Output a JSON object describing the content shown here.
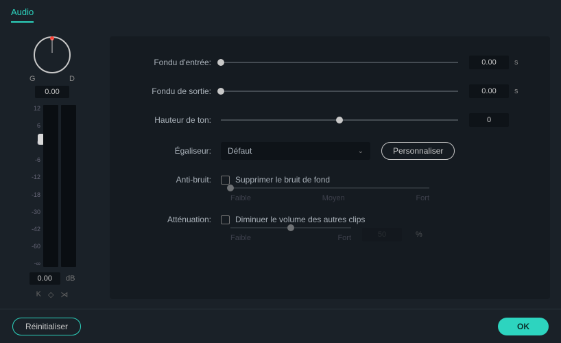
{
  "tab": {
    "label": "Audio"
  },
  "pan": {
    "left_label": "G",
    "right_label": "D",
    "value": "0.00"
  },
  "meter": {
    "ticks": [
      "12",
      "6",
      "0",
      "-6",
      "-12",
      "-18",
      "-30",
      "-42",
      "-60",
      "-∞"
    ],
    "volume_value": "0.00",
    "volume_unit": "dB"
  },
  "controls": {
    "fade_in": {
      "label": "Fondu d'entrée:",
      "value": "0.00",
      "unit": "s",
      "pos_pct": 0
    },
    "fade_out": {
      "label": "Fondu de sortie:",
      "value": "0.00",
      "unit": "s",
      "pos_pct": 0
    },
    "pitch": {
      "label": "Hauteur de ton:",
      "value": "0",
      "unit": "",
      "pos_pct": 50
    },
    "equalizer": {
      "label": "Égaliseur:",
      "selected": "Défaut",
      "customize_btn": "Personnaliser"
    },
    "denoise": {
      "label": "Anti-bruit:",
      "checkbox_label": "Supprimer le bruit de fond",
      "range_labels": [
        "Faible",
        "Moyen",
        "Fort"
      ],
      "pos_pct": 0
    },
    "ducking": {
      "label": "Atténuation:",
      "checkbox_label": "Diminuer le volume des autres clips",
      "range_labels": [
        "Faible",
        "Fort"
      ],
      "value": "50",
      "unit": "%",
      "pos_pct": 50
    }
  },
  "footer": {
    "reset": "Réinitialiser",
    "ok": "OK"
  }
}
